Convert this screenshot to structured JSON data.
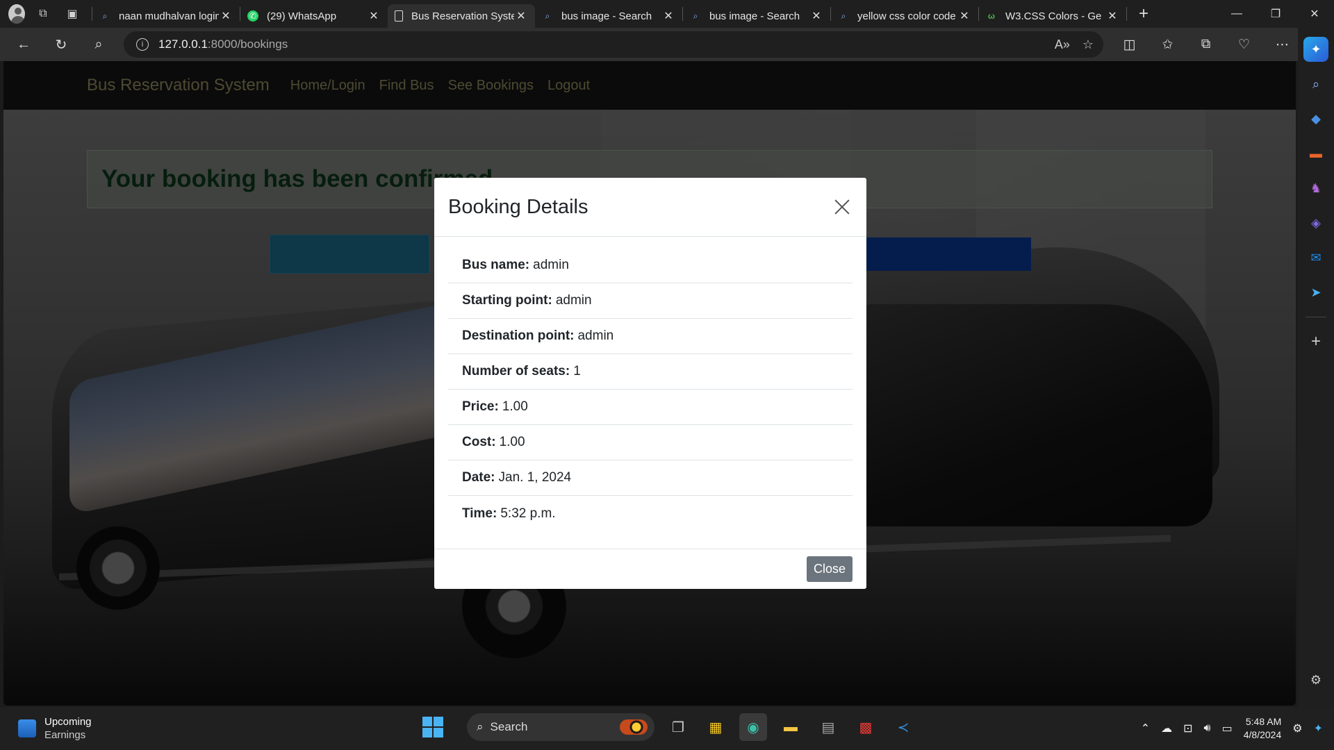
{
  "browser": {
    "tabs": [
      {
        "title": "naan mudhalvan login",
        "icon": "search-icon",
        "active": false
      },
      {
        "title": "(29) WhatsApp",
        "icon": "whatsapp-icon",
        "active": false
      },
      {
        "title": "Bus Reservation System",
        "icon": "page-icon",
        "active": true
      },
      {
        "title": "bus image - Search",
        "icon": "search-icon",
        "active": false
      },
      {
        "title": "bus image - Search",
        "icon": "search-icon",
        "active": false
      },
      {
        "title": "yellow css color code",
        "icon": "search-icon",
        "active": false
      },
      {
        "title": "W3.CSS Colors - Ge",
        "icon": "w3-icon",
        "active": false
      }
    ],
    "url_host": "127.0.0.1",
    "url_path": ":8000/bookings"
  },
  "site": {
    "brand": "Bus Reservation System",
    "nav": [
      "Home/Login",
      "Find Bus",
      "See Bookings",
      "Logout"
    ],
    "alert": "Your booking has been confirmed"
  },
  "modal": {
    "title": "Booking Details",
    "rows": [
      {
        "label": "Bus name:",
        "value": "admin"
      },
      {
        "label": "Starting point:",
        "value": "admin"
      },
      {
        "label": "Destination point:",
        "value": "admin"
      },
      {
        "label": "Number of seats:",
        "value": "1"
      },
      {
        "label": "Price:",
        "value": "1.00"
      },
      {
        "label": "Cost:",
        "value": "1.00"
      },
      {
        "label": "Date:",
        "value": "Jan. 1, 2024"
      },
      {
        "label": "Time:",
        "value": "5:32 p.m."
      }
    ],
    "close_label": "Close"
  },
  "taskbar": {
    "weather_title": "Upcoming",
    "weather_sub": "Earnings",
    "search_label": "Search",
    "time": "5:48 AM",
    "date": "4/8/2024"
  },
  "colors": {
    "brand_text": "#9a9465",
    "alert_text": "#0d3a1c",
    "close_button": "#6c757d",
    "bar_teal": "#1d6f8e",
    "bar_blue": "#0a3a99"
  }
}
